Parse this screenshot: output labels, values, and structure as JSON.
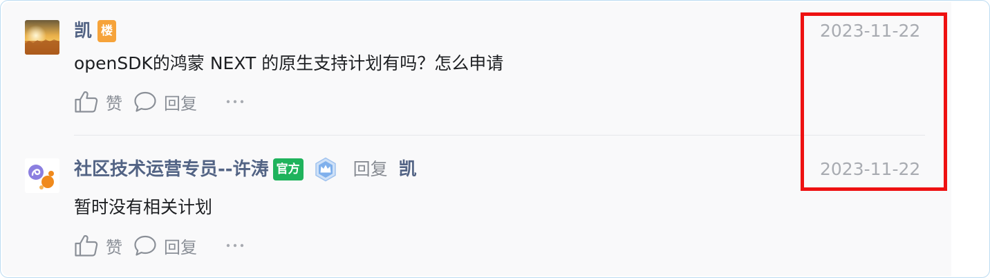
{
  "comments": [
    {
      "author": "凯",
      "tag": "楼",
      "text": "openSDK的鸿蒙 NEXT 的原生支持计划有吗？怎么申请",
      "date": "2023-11-22",
      "like_label": "赞",
      "reply_label": "回复"
    },
    {
      "author": "社区技术运营专员--许涛",
      "tag": "官方",
      "reply_word": "回复",
      "reply_target": "凯",
      "text": "暂时没有相关计划",
      "date": "2023-11-22",
      "like_label": "赞",
      "reply_label": "回复"
    }
  ],
  "icons": {
    "like": "thumbs-up-icon",
    "reply": "speech-bubble-icon",
    "more": "more-dots-icon",
    "badge": "crown-shield-badge-icon"
  },
  "colors": {
    "author": "#526384",
    "floor_tag": "#f6a33a",
    "official_tag": "#1fb35c",
    "muted": "#8a8f97",
    "highlight": "#ee1111"
  }
}
